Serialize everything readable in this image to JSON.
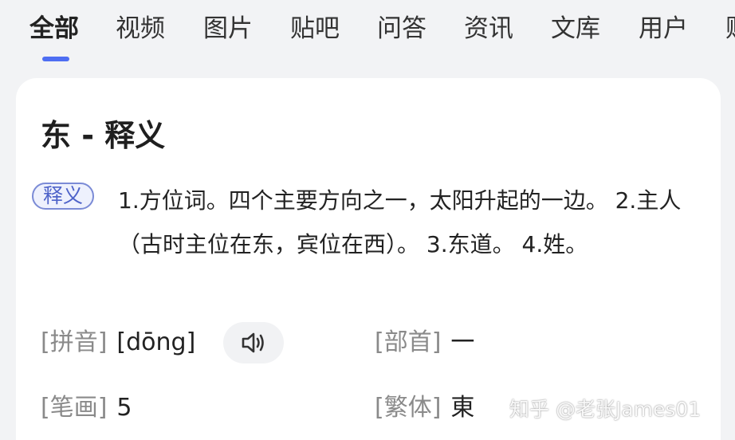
{
  "tabs": [
    {
      "label": "全部",
      "active": true
    },
    {
      "label": "视频",
      "active": false
    },
    {
      "label": "图片",
      "active": false
    },
    {
      "label": "贴吧",
      "active": false
    },
    {
      "label": "问答",
      "active": false
    },
    {
      "label": "资讯",
      "active": false
    },
    {
      "label": "文库",
      "active": false
    },
    {
      "label": "用户",
      "active": false
    },
    {
      "label": "财",
      "active": false
    }
  ],
  "accent_color": "#4e6ef2",
  "card": {
    "title": "东 - 释义",
    "definition_badge": "释义",
    "definition_text": "1.方位词。四个主要方向之一，太阳升起的一边。 2.主人（古时主位在东，宾位在西）。 3.东道。 4.姓。",
    "pinyin_label": "[拼音]",
    "pinyin_value": "[dōng]",
    "speaker_icon": "speaker-icon",
    "radical_label": "[部首]",
    "radical_value": "一",
    "strokes_label": "[笔画]",
    "strokes_value": "5",
    "traditional_label": "[繁体]",
    "traditional_value": "東"
  },
  "watermark": "知乎 @老张James01"
}
